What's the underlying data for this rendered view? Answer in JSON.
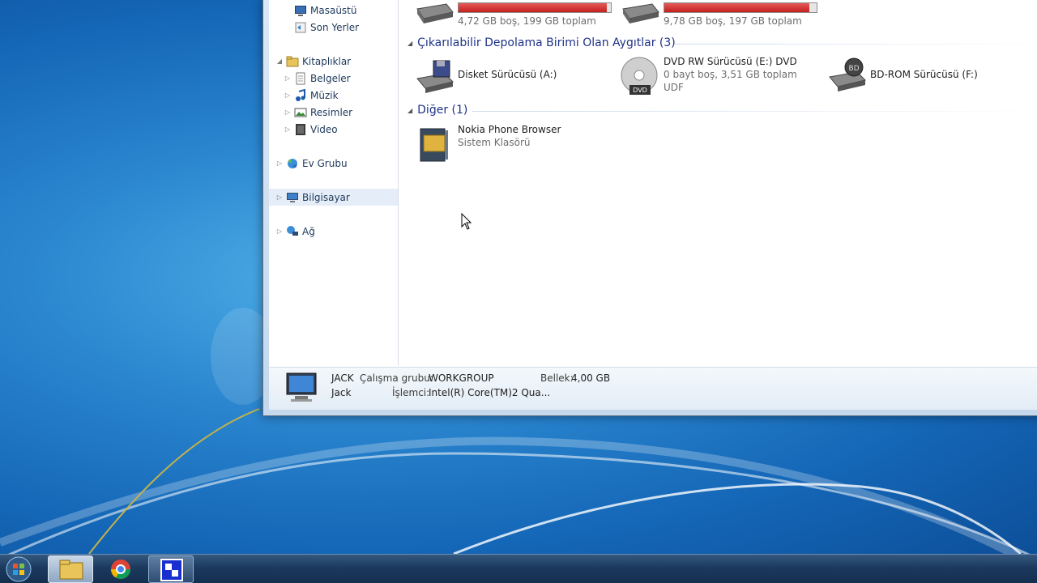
{
  "nav": {
    "desktop": "Masaüstü",
    "recent": "Son Yerler",
    "libraries": "Kitaplıklar",
    "documents": "Belgeler",
    "music": "Müzik",
    "pictures": "Resimler",
    "video": "Video",
    "homegroup": "Ev Grubu",
    "computer": "Bilgisayar",
    "network": "Ağ"
  },
  "drives_top": [
    {
      "text": "4,72 GB boş, 199 GB toplam",
      "used_fraction": 0.976
    },
    {
      "text": "9,78 GB boş, 197 GB toplam",
      "used_fraction": 0.95
    }
  ],
  "groups": {
    "removable": "Çıkarılabilir Depolama Birimi Olan Aygıtlar (3)",
    "other": "Diğer (1)"
  },
  "removable": {
    "floppy": "Disket Sürücüsü (A:)",
    "dvd_name": "DVD RW Sürücüsü (E:) DVD",
    "dvd_space": "0 bayt boş, 3,51 GB toplam",
    "dvd_fs": "UDF",
    "dvd_badge": "DVD",
    "bd_name": "BD-ROM Sürücüsü (F:)",
    "bd_badge": "BD"
  },
  "other": {
    "name": "Nokia Phone Browser",
    "sub": "Sistem Klasörü"
  },
  "details": {
    "computer_name": "JACK",
    "user": "Jack",
    "workgroup_label": "Çalışma grubu:",
    "workgroup_value": "WORKGROUP",
    "cpu_label": "İşlemci:",
    "cpu_value": "Intel(R) Core(TM)2 Qua...",
    "memory_label": "Bellek:",
    "memory_value": "4,00 GB"
  },
  "colors": {
    "accent": "#1e3287",
    "bar_fill": "#c31f1f"
  }
}
